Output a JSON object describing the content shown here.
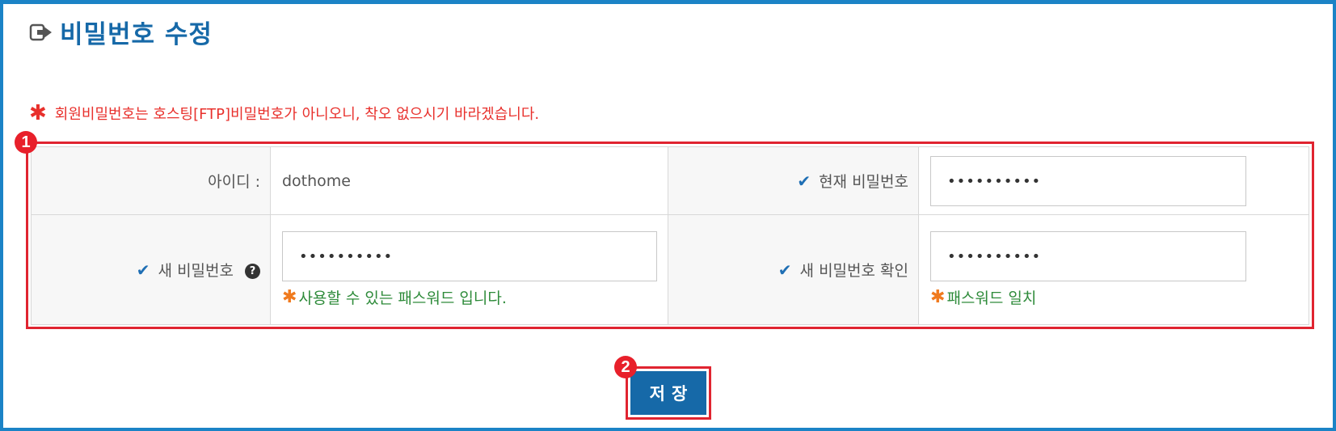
{
  "page": {
    "title": "비밀번호 수정"
  },
  "notice": {
    "star": "✱",
    "text": "회원비밀번호는 호스팅[FTP]비밀번호가 아니오니, 착오 없으시기 바라겠습니다."
  },
  "badges": {
    "form": "1",
    "save": "2"
  },
  "form": {
    "id_label": "아이디 :",
    "id_value": "dothome",
    "current_pw_label": "현재 비밀번호",
    "current_pw_value": "••••••••••",
    "new_pw_label": "새 비밀번호",
    "new_pw_value": "••••••••••",
    "new_pw_hint_star": "✱",
    "new_pw_hint": "사용할 수 있는 패스워드 입니다.",
    "confirm_pw_label": "새 비밀번호 확인",
    "confirm_pw_value": "••••••••••",
    "confirm_pw_hint_star": "✱",
    "confirm_pw_hint": "패스워드 일치",
    "check_mark": "✔",
    "help_mark": "?"
  },
  "buttons": {
    "save_label": "저장"
  },
  "colors": {
    "frame": "#1b83c6",
    "title": "#1669a8",
    "notice": "#e8302c",
    "highlight": "#e02430",
    "hint": "#2e8b3a",
    "button": "#1669a8"
  },
  "icons": {
    "title": "exit-arrow-icon",
    "check": "checkmark-icon",
    "help": "question-circle-icon"
  }
}
